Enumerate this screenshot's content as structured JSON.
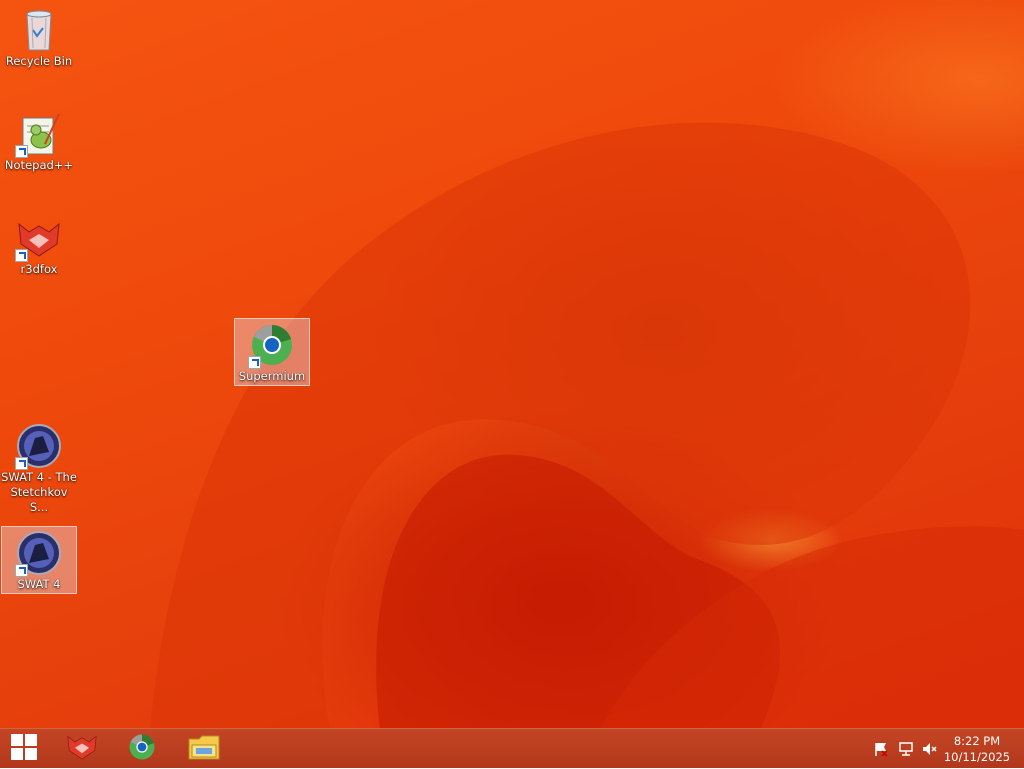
{
  "desktop": {
    "icons": [
      {
        "id": "recycle-bin",
        "label": "Recycle Bin",
        "icon": "recycle-bin-icon",
        "shortcut": false,
        "selected": false
      },
      {
        "id": "notepadpp",
        "label": "Notepad++",
        "icon": "notepad-plus-plus-icon",
        "shortcut": true,
        "selected": false
      },
      {
        "id": "r3dfox",
        "label": "r3dfox",
        "icon": "r3dfox-icon",
        "shortcut": true,
        "selected": false
      },
      {
        "id": "supermium",
        "label": "Supermium",
        "icon": "supermium-icon",
        "shortcut": true,
        "selected": true
      },
      {
        "id": "swat4-stetchkov",
        "label_line1": "SWAT 4 - The",
        "label_line2": "Stetchkov S...",
        "icon": "swat4-icon",
        "shortcut": true,
        "selected": false
      },
      {
        "id": "swat4",
        "label": "SWAT 4",
        "icon": "swat4-icon",
        "shortcut": true,
        "selected": true
      }
    ]
  },
  "taskbar": {
    "start": {
      "icon": "windows-logo-icon"
    },
    "pinned": [
      {
        "id": "r3dfox",
        "icon": "r3dfox-icon"
      },
      {
        "id": "supermium",
        "icon": "supermium-icon"
      },
      {
        "id": "file-explorer",
        "icon": "folder-icon"
      }
    ],
    "tray": {
      "icons": [
        "action-center-flag-icon",
        "network-icon",
        "volume-muted-icon"
      ],
      "time": "8:22 PM",
      "date": "10/11/2025"
    }
  },
  "colors": {
    "wallpaper_primary": "#ef4a0c",
    "wallpaper_dark": "#c81e04",
    "taskbar": "#b8381a"
  }
}
